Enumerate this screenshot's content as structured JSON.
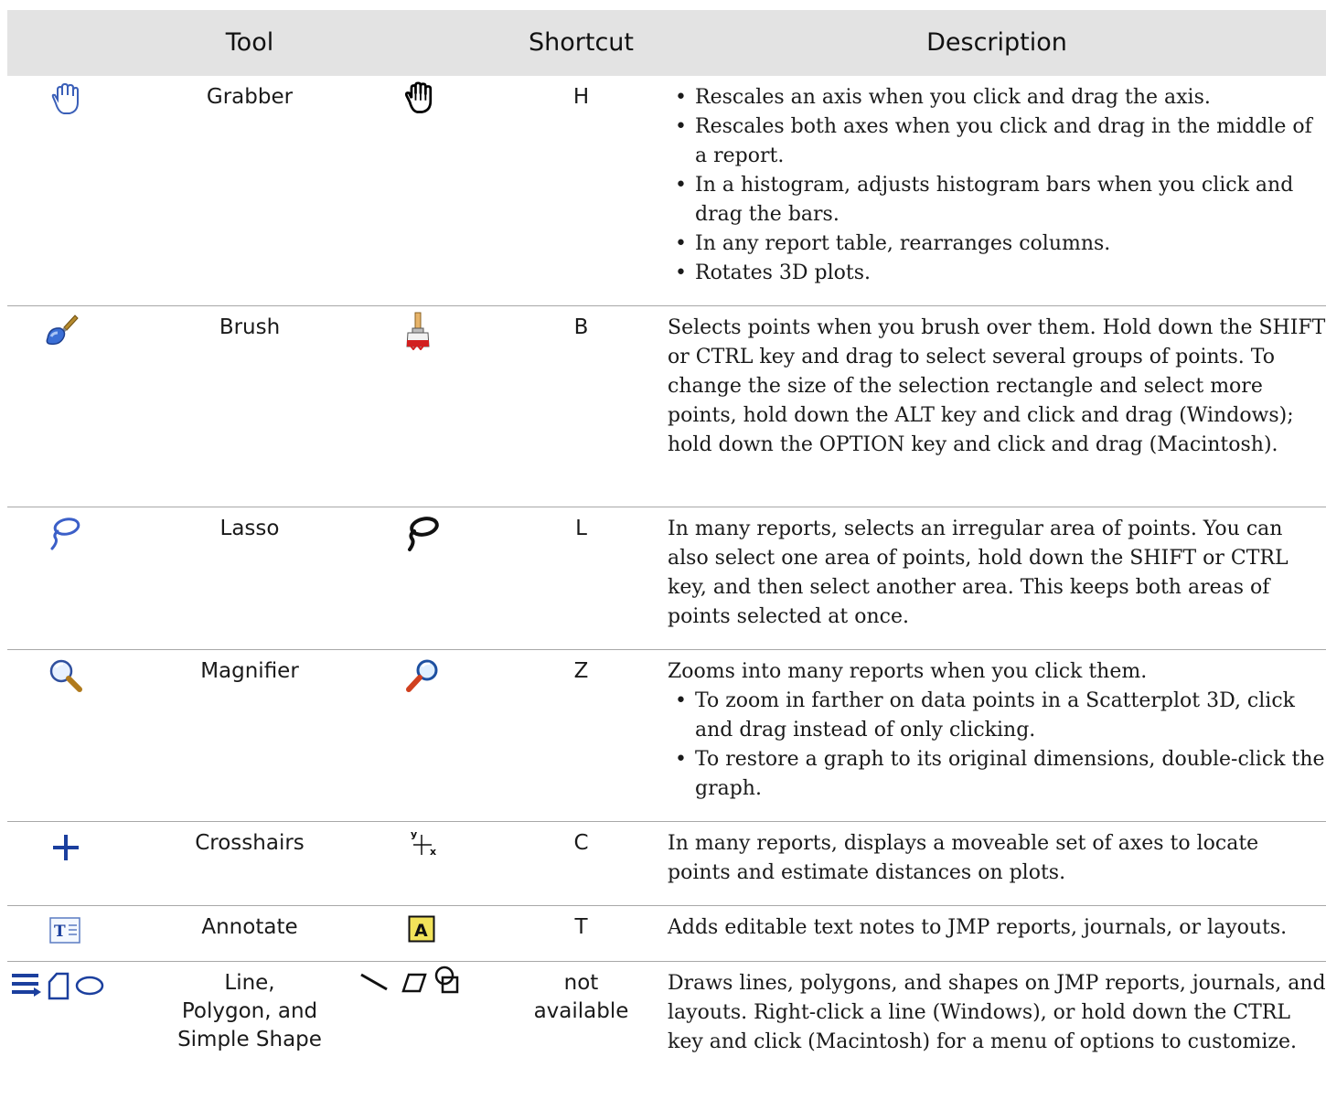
{
  "header": {
    "tool": "Tool",
    "shortcut": "Shortcut",
    "description": "Description"
  },
  "rows": [
    {
      "name": "Grabber",
      "shortcut": "H",
      "tool_icon": "hand-icon",
      "cursor_icon": "hand-cursor-icon",
      "intro": "",
      "bullets": [
        "Rescales an axis when you click and drag the axis.",
        "Rescales both axes when you click and drag in the middle of a report.",
        "In a histogram, adjusts histogram bars when you click and drag the bars.",
        "In any report table, rearranges columns.",
        "Rotates 3D plots."
      ]
    },
    {
      "name": "Brush",
      "shortcut": "B",
      "tool_icon": "brush-icon",
      "cursor_icon": "paintbrush-cursor-icon",
      "intro": "Selects points when you brush over them. Hold down the SHIFT or CTRL key and drag to select several groups of points. To change the size of the selection rectangle and select more points, hold down the ALT key and click and drag (Windows); hold down the OPTION key and click and drag (Macintosh).",
      "bullets": []
    },
    {
      "name": "Lasso",
      "shortcut": "L",
      "tool_icon": "lasso-icon",
      "cursor_icon": "lasso-cursor-icon",
      "intro": "In many reports, selects an irregular area of points. You can also select one area of points, hold down the SHIFT or CTRL key, and then select another area. This keeps both areas of points selected at once.",
      "bullets": []
    },
    {
      "name": "Magnifier",
      "shortcut": "Z",
      "tool_icon": "magnifier-icon",
      "cursor_icon": "magnifier-cursor-icon",
      "intro": "Zooms into many reports when you click them.",
      "bullets": [
        "To zoom in farther on data points in a Scatterplot 3D, click and drag instead of only clicking.",
        "To restore a graph to its original dimensions, double-click the graph."
      ]
    },
    {
      "name": "Crosshairs",
      "shortcut": "C",
      "tool_icon": "crosshairs-icon",
      "cursor_icon": "crosshairs-cursor-icon",
      "intro": "In many reports, displays a moveable set of axes to locate points and estimate distances on plots.",
      "bullets": []
    },
    {
      "name": "Annotate",
      "shortcut": "T",
      "tool_icon": "annotate-icon",
      "cursor_icon": "annotate-cursor-icon",
      "intro": "Adds editable text notes to JMP reports, journals, or layouts.",
      "bullets": []
    },
    {
      "name": "Line,\nPolygon, and\nSimple Shape",
      "shortcut": "not\navailable",
      "tool_icon": "shapes-icon",
      "cursor_icon": "shapes-cursor-icon",
      "intro": "Draws lines, polygons, and shapes on JMP reports, journals, and layouts. Right-click a line (Windows), or hold down the CTRL key and click (Macintosh) for a menu of options to customize.",
      "bullets": []
    }
  ]
}
